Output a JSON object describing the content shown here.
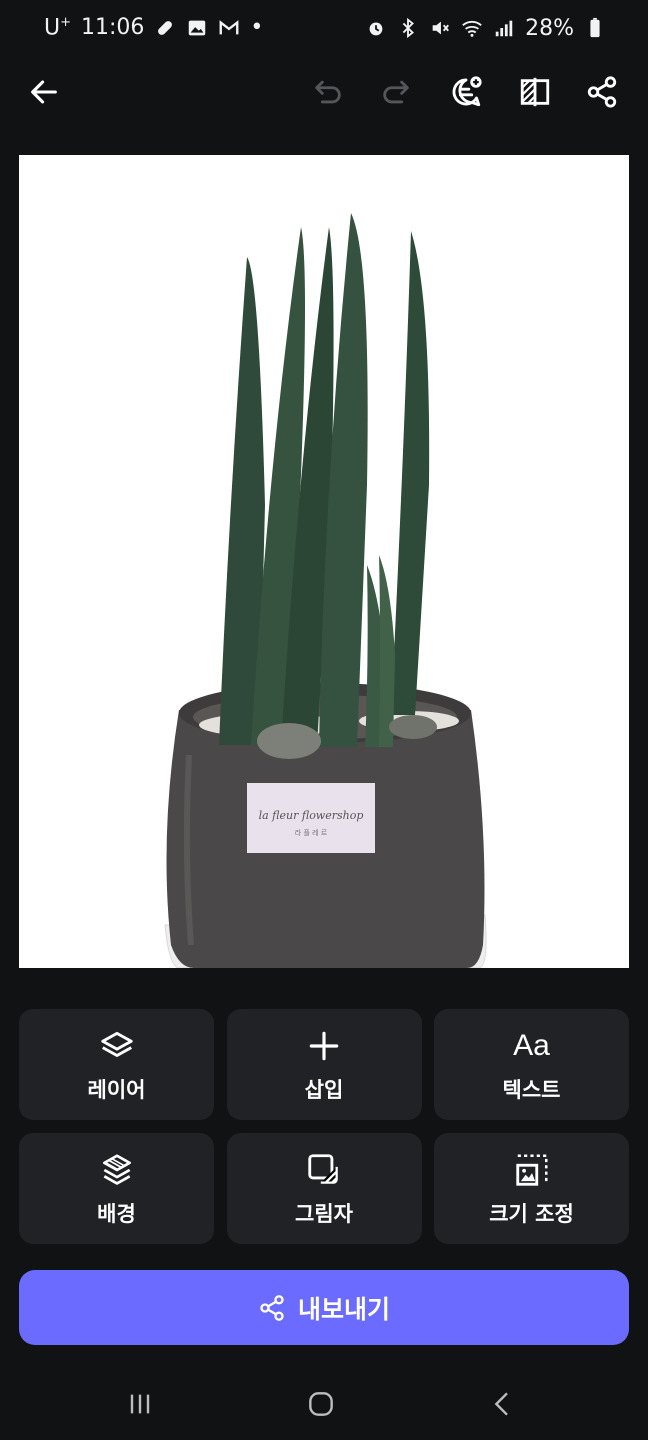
{
  "status_bar": {
    "carrier": "U",
    "carrier_sup": "+",
    "time": "11:06",
    "dot": "•",
    "battery": "28%"
  },
  "toolbar": {
    "icons": [
      "back-arrow-icon",
      "undo-icon",
      "redo-icon",
      "add-comment-icon",
      "compare-icon",
      "share-icon"
    ]
  },
  "tools": [
    {
      "label": "레이어",
      "icon": "layers-icon"
    },
    {
      "label": "삽입",
      "icon": "plus-icon"
    },
    {
      "label": "텍스트",
      "icon": "text-icon",
      "glyph": "Aa"
    },
    {
      "label": "배경",
      "icon": "background-icon"
    },
    {
      "label": "그림자",
      "icon": "shadow-icon"
    },
    {
      "label": "크기 조정",
      "icon": "resize-icon"
    }
  ],
  "export_button": {
    "label": "내보내기",
    "color": "#6b6cff"
  },
  "canvas": {
    "pot_label_line1": "la fleur flowershop",
    "pot_label_line2": "라 플 레 르"
  },
  "colors": {
    "background": "#111214",
    "tile": "#212226",
    "accent": "#6b6cff"
  }
}
